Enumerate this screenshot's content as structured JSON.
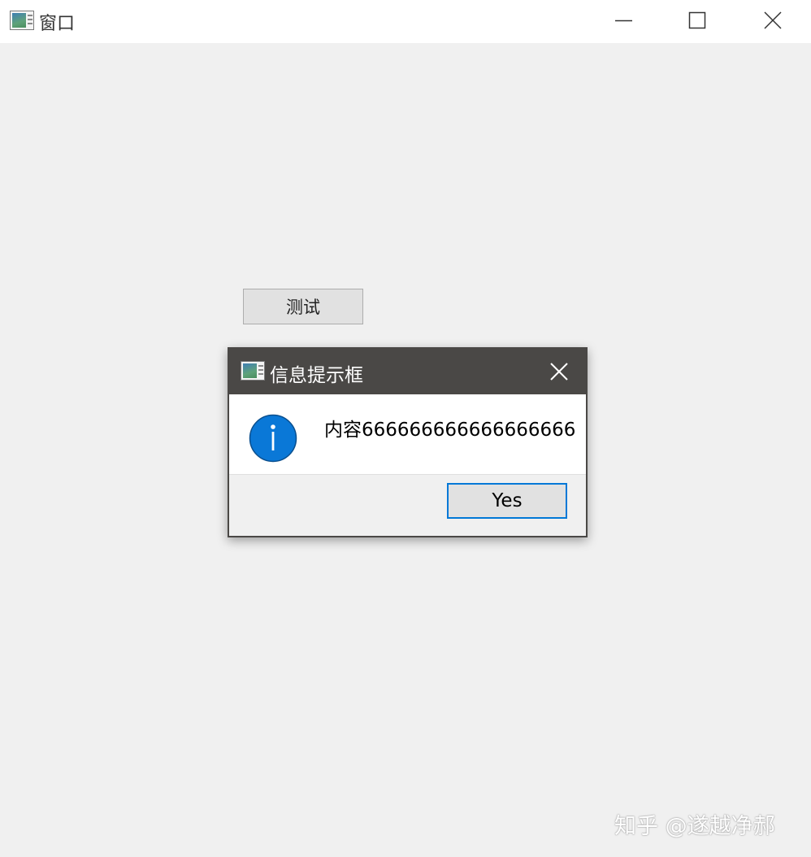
{
  "window": {
    "title": "窗口",
    "icon": "app-window-icon",
    "controls": [
      "minimize-icon",
      "maximize-icon",
      "close-icon"
    ]
  },
  "main": {
    "test_button_label": "测试"
  },
  "dialog": {
    "title": "信息提示框",
    "icon": "app-window-icon",
    "message": "内容666666666666666666",
    "message_icon": "info-icon",
    "yes_label": "Yes",
    "accent_color": "#0078d7",
    "titlebar_color": "#4a4846"
  },
  "watermark": {
    "text": "知乎 @遂越净郝"
  }
}
